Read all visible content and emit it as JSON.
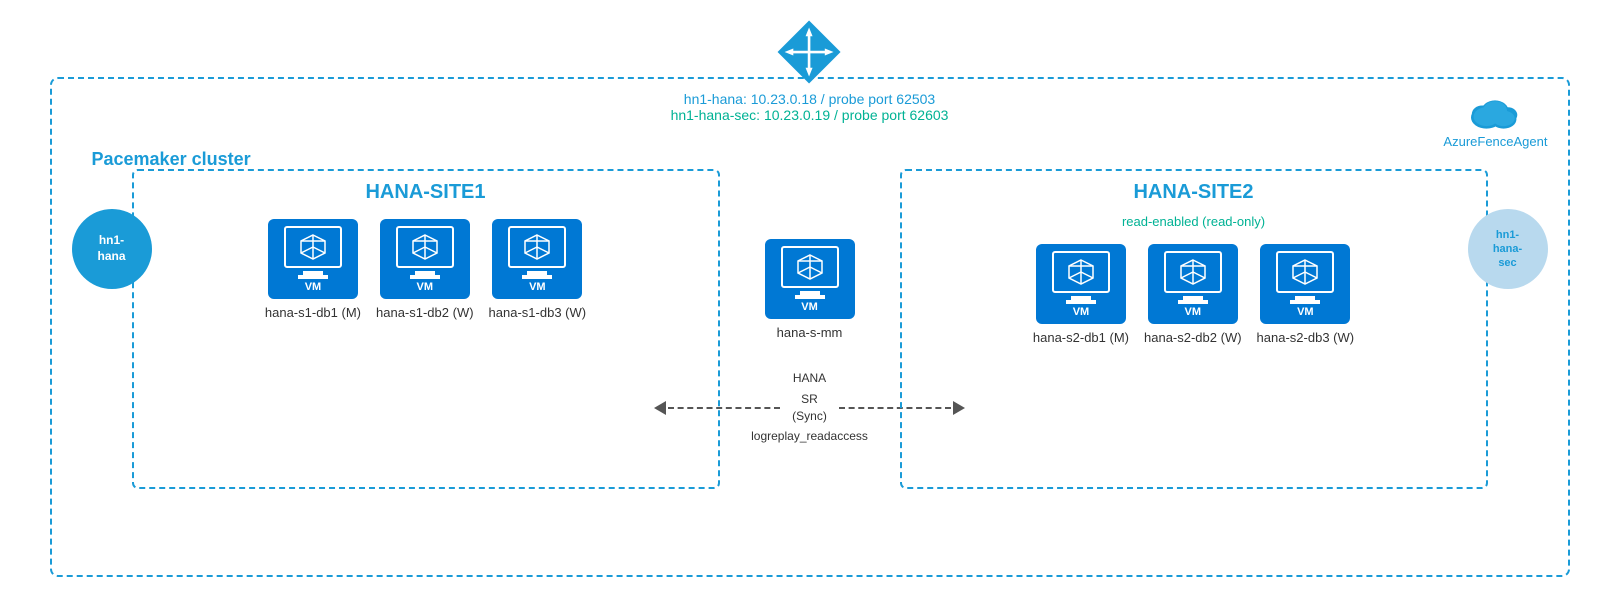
{
  "pacemaker": {
    "label": "Pacemaker cluster"
  },
  "loadbalancer": {
    "primary_label": "hn1-hana:  10.23.0.18 / probe port 62503",
    "secondary_label": "hn1-hana-sec:  10.23.0.19 / probe port 62603"
  },
  "fence_agent": {
    "label": "AzureFenceAgent"
  },
  "site1": {
    "title": "HANA-SITE1",
    "vip_label": "hn1-\nhana",
    "vms": [
      {
        "name": "hana-s1-db1 (M)"
      },
      {
        "name": "hana-s1-db2 (W)"
      },
      {
        "name": "hana-s1-db3 (W)"
      }
    ]
  },
  "middle": {
    "vm_name": "hana-s-mm"
  },
  "site2": {
    "title": "HANA-SITE2",
    "read_enabled": "read-enabled (read-only)",
    "vip_label": "hn1-\nhana-\nsec",
    "vms": [
      {
        "name": "hana-s2-db1 (M)"
      },
      {
        "name": "hana-s2-db2 (W)"
      },
      {
        "name": "hana-s2-db3 (W)"
      }
    ]
  },
  "hana_sr": {
    "line1": "HANA",
    "line2": "SR (Sync)",
    "line3": "logreplay_readaccess"
  }
}
